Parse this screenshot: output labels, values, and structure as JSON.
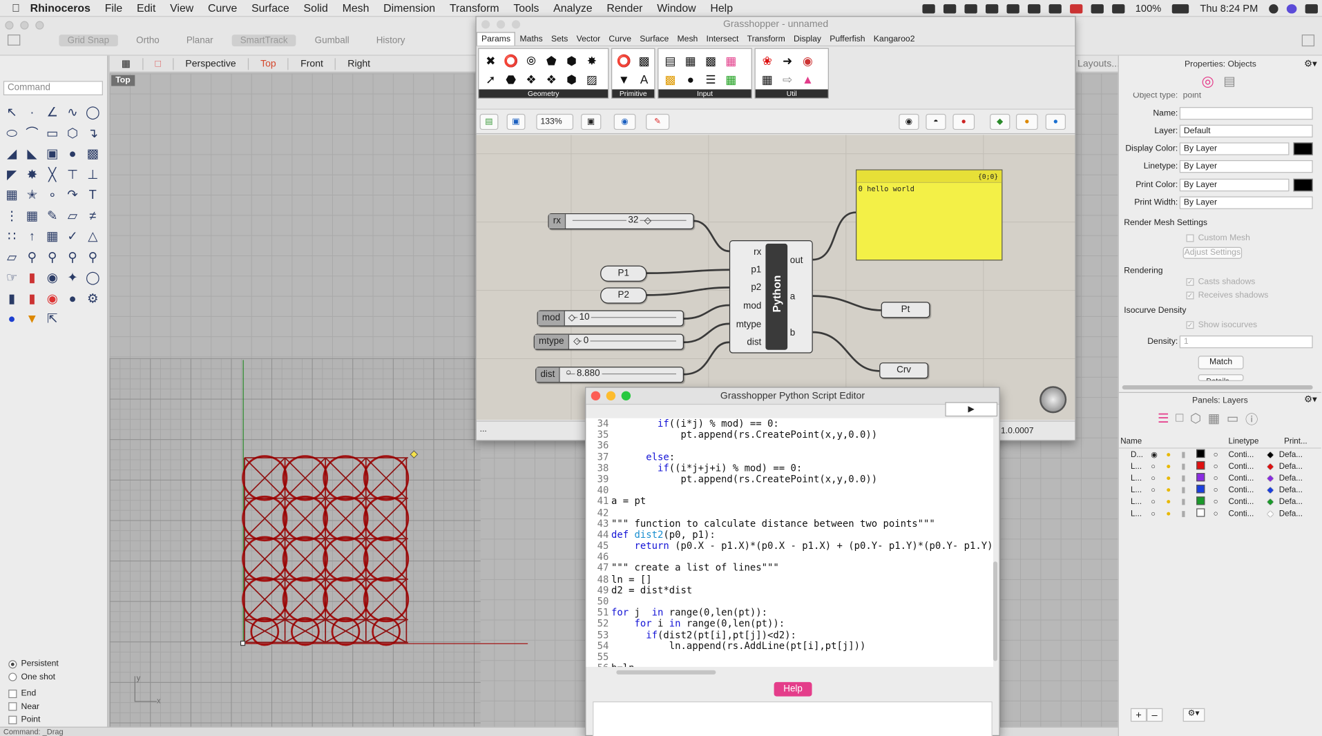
{
  "menubar": {
    "app": "Rhinoceros",
    "items": [
      "File",
      "Edit",
      "View",
      "Curve",
      "Surface",
      "Solid",
      "Mesh",
      "Dimension",
      "Transform",
      "Tools",
      "Analyze",
      "Render",
      "Window",
      "Help"
    ],
    "battery": "100%",
    "clock": "Thu 8:24 PM"
  },
  "rhino": {
    "snaps": [
      "Grid Snap",
      "Ortho",
      "Planar",
      "SmartTrack",
      "Gumball",
      "History"
    ],
    "command_placeholder": "Command",
    "view_tabs": [
      "Perspective",
      "Top",
      "Front",
      "Right"
    ],
    "active_tab": "Top",
    "viewport_label": "Top",
    "layouts_label": "Layouts...",
    "osnap": [
      "Persistent",
      "One shot",
      "End",
      "Near",
      "Point"
    ],
    "status": "Command: _Drag"
  },
  "properties": {
    "title": "Properties: Objects",
    "object_type_label": "Object type:",
    "object_type": "point",
    "name_label": "Name:",
    "name": "",
    "layer_label": "Layer:",
    "layer": "Default",
    "display_color_label": "Display Color:",
    "display_color": "By Layer",
    "linetype_label": "Linetype:",
    "linetype": "By Layer",
    "print_color_label": "Print Color:",
    "print_color": "By Layer",
    "print_width_label": "Print Width:",
    "print_width": "By Layer",
    "render_mesh": "Render Mesh Settings",
    "custom_mesh": "Custom Mesh",
    "adjust_settings": "Adjust Settings",
    "rendering": "Rendering",
    "casts_shadows": "Casts shadows",
    "receives_shadows": "Receives shadows",
    "isocurve": "Isocurve Density",
    "show_isocurves": "Show isocurves",
    "density_label": "Density:",
    "density": "1",
    "match": "Match",
    "details": "Details..."
  },
  "layers": {
    "title": "Panels: Layers",
    "col_name": "Name",
    "col_linetype": "Linetype",
    "col_print": "Print...",
    "rows": [
      {
        "name": "D...",
        "color": "#000000",
        "linetype": "Conti...",
        "print": "Defa..."
      },
      {
        "name": "L...",
        "color": "#e01010",
        "linetype": "Conti...",
        "print": "Defa..."
      },
      {
        "name": "L...",
        "color": "#8a2be2",
        "linetype": "Conti...",
        "print": "Defa..."
      },
      {
        "name": "L...",
        "color": "#1a3fe0",
        "linetype": "Conti...",
        "print": "Defa..."
      },
      {
        "name": "L...",
        "color": "#1a9a2a",
        "linetype": "Conti...",
        "print": "Defa..."
      },
      {
        "name": "L...",
        "color": "#ffffff",
        "linetype": "Conti...",
        "print": "Defa..."
      }
    ]
  },
  "grasshopper": {
    "title": "Grasshopper - unnamed",
    "tabs": [
      "Params",
      "Maths",
      "Sets",
      "Vector",
      "Curve",
      "Surface",
      "Mesh",
      "Intersect",
      "Transform",
      "Display",
      "Pufferfish",
      "Kangaroo2"
    ],
    "groups": [
      "Geometry",
      "Primitive",
      "Input",
      "Util"
    ],
    "zoom": "133%",
    "sliders": [
      {
        "name": "rx",
        "value": "32"
      },
      {
        "name": "mod",
        "value": "10"
      },
      {
        "name": "mtype",
        "value": "0"
      },
      {
        "name": "dist",
        "value": "8.880"
      }
    ],
    "params": {
      "p1": "P1",
      "p2": "P2",
      "pt": "Pt",
      "crv": "Crv"
    },
    "python": {
      "label": "Python",
      "inputs": [
        "rx",
        "p1",
        "p2",
        "mod",
        "mtype",
        "dist"
      ],
      "outputs": [
        "out",
        "a",
        "b"
      ]
    },
    "panel": {
      "path": "{0;0}",
      "index": "0",
      "text": "hello world"
    },
    "status_left": "...",
    "version": "1.0.0007"
  },
  "editor": {
    "title": "Grasshopper Python Script Editor",
    "run": "▶",
    "help": "Help"
  }
}
